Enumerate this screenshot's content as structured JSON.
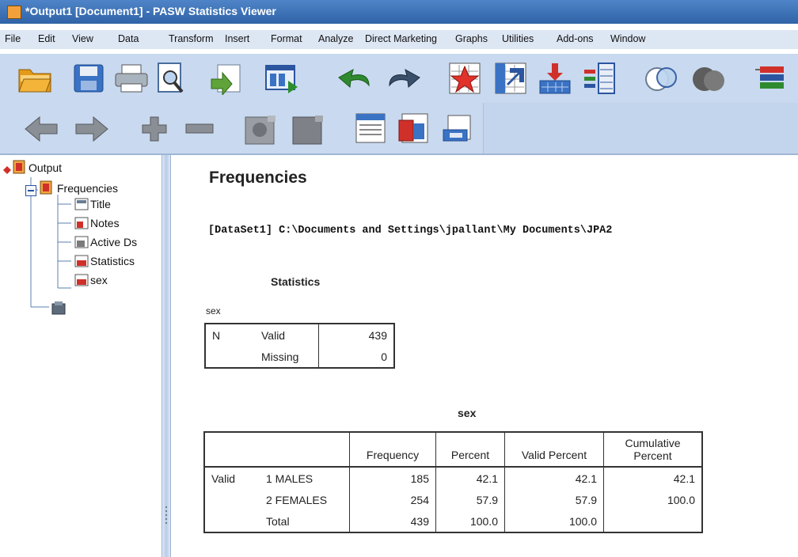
{
  "window": {
    "title": "*Output1 [Document1] - PASW Statistics Viewer"
  },
  "menu": [
    "File",
    "Edit",
    "View",
    "Data",
    "Transform",
    "Insert",
    "Format",
    "Analyze",
    "Direct Marketing",
    "Graphs",
    "Utilities",
    "Add-ons",
    "Window"
  ],
  "toolbar1": [
    "open-folder-icon",
    "save-icon",
    "print-icon",
    "print-preview-icon",
    "export-icon",
    "recall-dialog-icon",
    "undo-icon",
    "redo-icon",
    "goto-case-icon",
    "goto-variable-icon",
    "insert-cases-icon",
    "insert-variable-icon",
    "split-file-icon",
    "weight-cases-icon",
    "value-labels-icon"
  ],
  "toolbar2": [
    "back-icon",
    "forward-icon",
    "expand-icon",
    "collapse-icon",
    "show-icon",
    "hide-icon",
    "insert-heading-icon",
    "insert-title-icon",
    "insert-text-icon"
  ],
  "nav": {
    "root": "Output",
    "frequencies": "Frequencies",
    "children": [
      "Title",
      "Notes",
      "Active Ds",
      "Statistics",
      "sex"
    ]
  },
  "output": {
    "heading": "Frequencies",
    "dataset": "[DataSet1] C:\\Documents and Settings\\jpallant\\My Documents\\JPA2",
    "stats": {
      "title": "Statistics",
      "variable": "sex",
      "rowhead": "N",
      "rows": [
        {
          "label": "Valid",
          "value": "439"
        },
        {
          "label": "Missing",
          "value": "0"
        }
      ]
    },
    "freq": {
      "title": "sex",
      "headers": [
        "Frequency",
        "Percent",
        "Valid Percent",
        "Cumulative Percent"
      ],
      "group": "Valid",
      "rows": [
        {
          "label": "1 MALES",
          "frequency": "185",
          "percent": "42.1",
          "valid_percent": "42.1",
          "cumulative": "42.1"
        },
        {
          "label": "2 FEMALES",
          "frequency": "254",
          "percent": "57.9",
          "valid_percent": "57.9",
          "cumulative": "100.0"
        },
        {
          "label": "Total",
          "frequency": "439",
          "percent": "100.0",
          "valid_percent": "100.0",
          "cumulative": ""
        }
      ]
    }
  }
}
